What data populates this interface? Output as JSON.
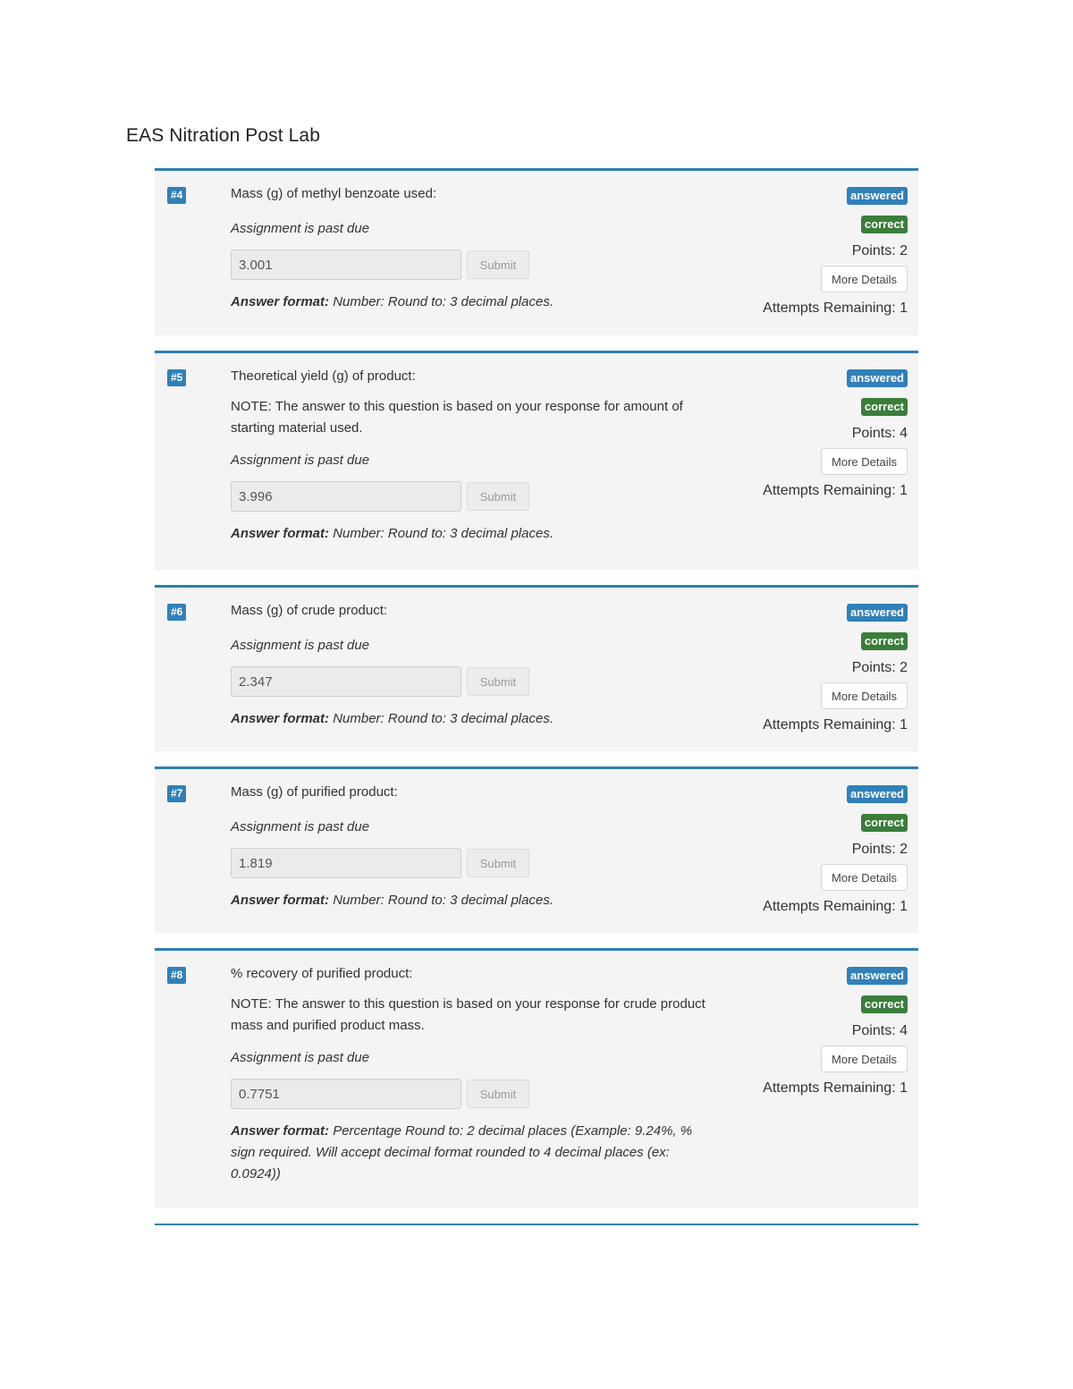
{
  "page": {
    "title": "EAS Nitration Post Lab"
  },
  "labels": {
    "due": "Assignment is past due",
    "submit": "Submit",
    "answered": "answered",
    "correct": "correct",
    "more_details": "More Details",
    "answer_format_label": "Answer format:"
  },
  "questions": [
    {
      "number": "#4",
      "prompt": "Mass (g) of methyl benzoate used:",
      "note": "",
      "value": "3.001",
      "format": "Number: Round to: 3 decimal places.",
      "points": "Points: 2",
      "attempts": "Attempts Remaining: 1"
    },
    {
      "number": "#5",
      "prompt": "Theoretical yield (g) of product:",
      "note": "NOTE: The answer to this question is based on your response for amount of starting material used.",
      "value": "3.996",
      "format": "Number: Round to: 3 decimal places.",
      "points": "Points: 4",
      "attempts": "Attempts Remaining: 1"
    },
    {
      "number": "#6",
      "prompt": "Mass (g) of crude product:",
      "note": "",
      "value": "2.347",
      "format": "Number: Round to: 3 decimal places.",
      "points": "Points: 2",
      "attempts": "Attempts Remaining: 1"
    },
    {
      "number": "#7",
      "prompt": "Mass (g) of purified product:",
      "note": "",
      "value": "1.819",
      "format": "Number: Round to: 3 decimal places.",
      "points": "Points: 2",
      "attempts": "Attempts Remaining: 1"
    },
    {
      "number": "#8",
      "prompt": "% recovery of purified product:",
      "note": "NOTE: The answer to this question is based on your response for crude product mass and purified product mass.",
      "value": "0.7751",
      "format": "Percentage Round to: 2 decimal places (Example: 9.24%, % sign required. Will accept decimal format rounded to 4 decimal places (ex: 0.0924))",
      "points": "Points: 4",
      "attempts": "Attempts Remaining: 1"
    }
  ]
}
